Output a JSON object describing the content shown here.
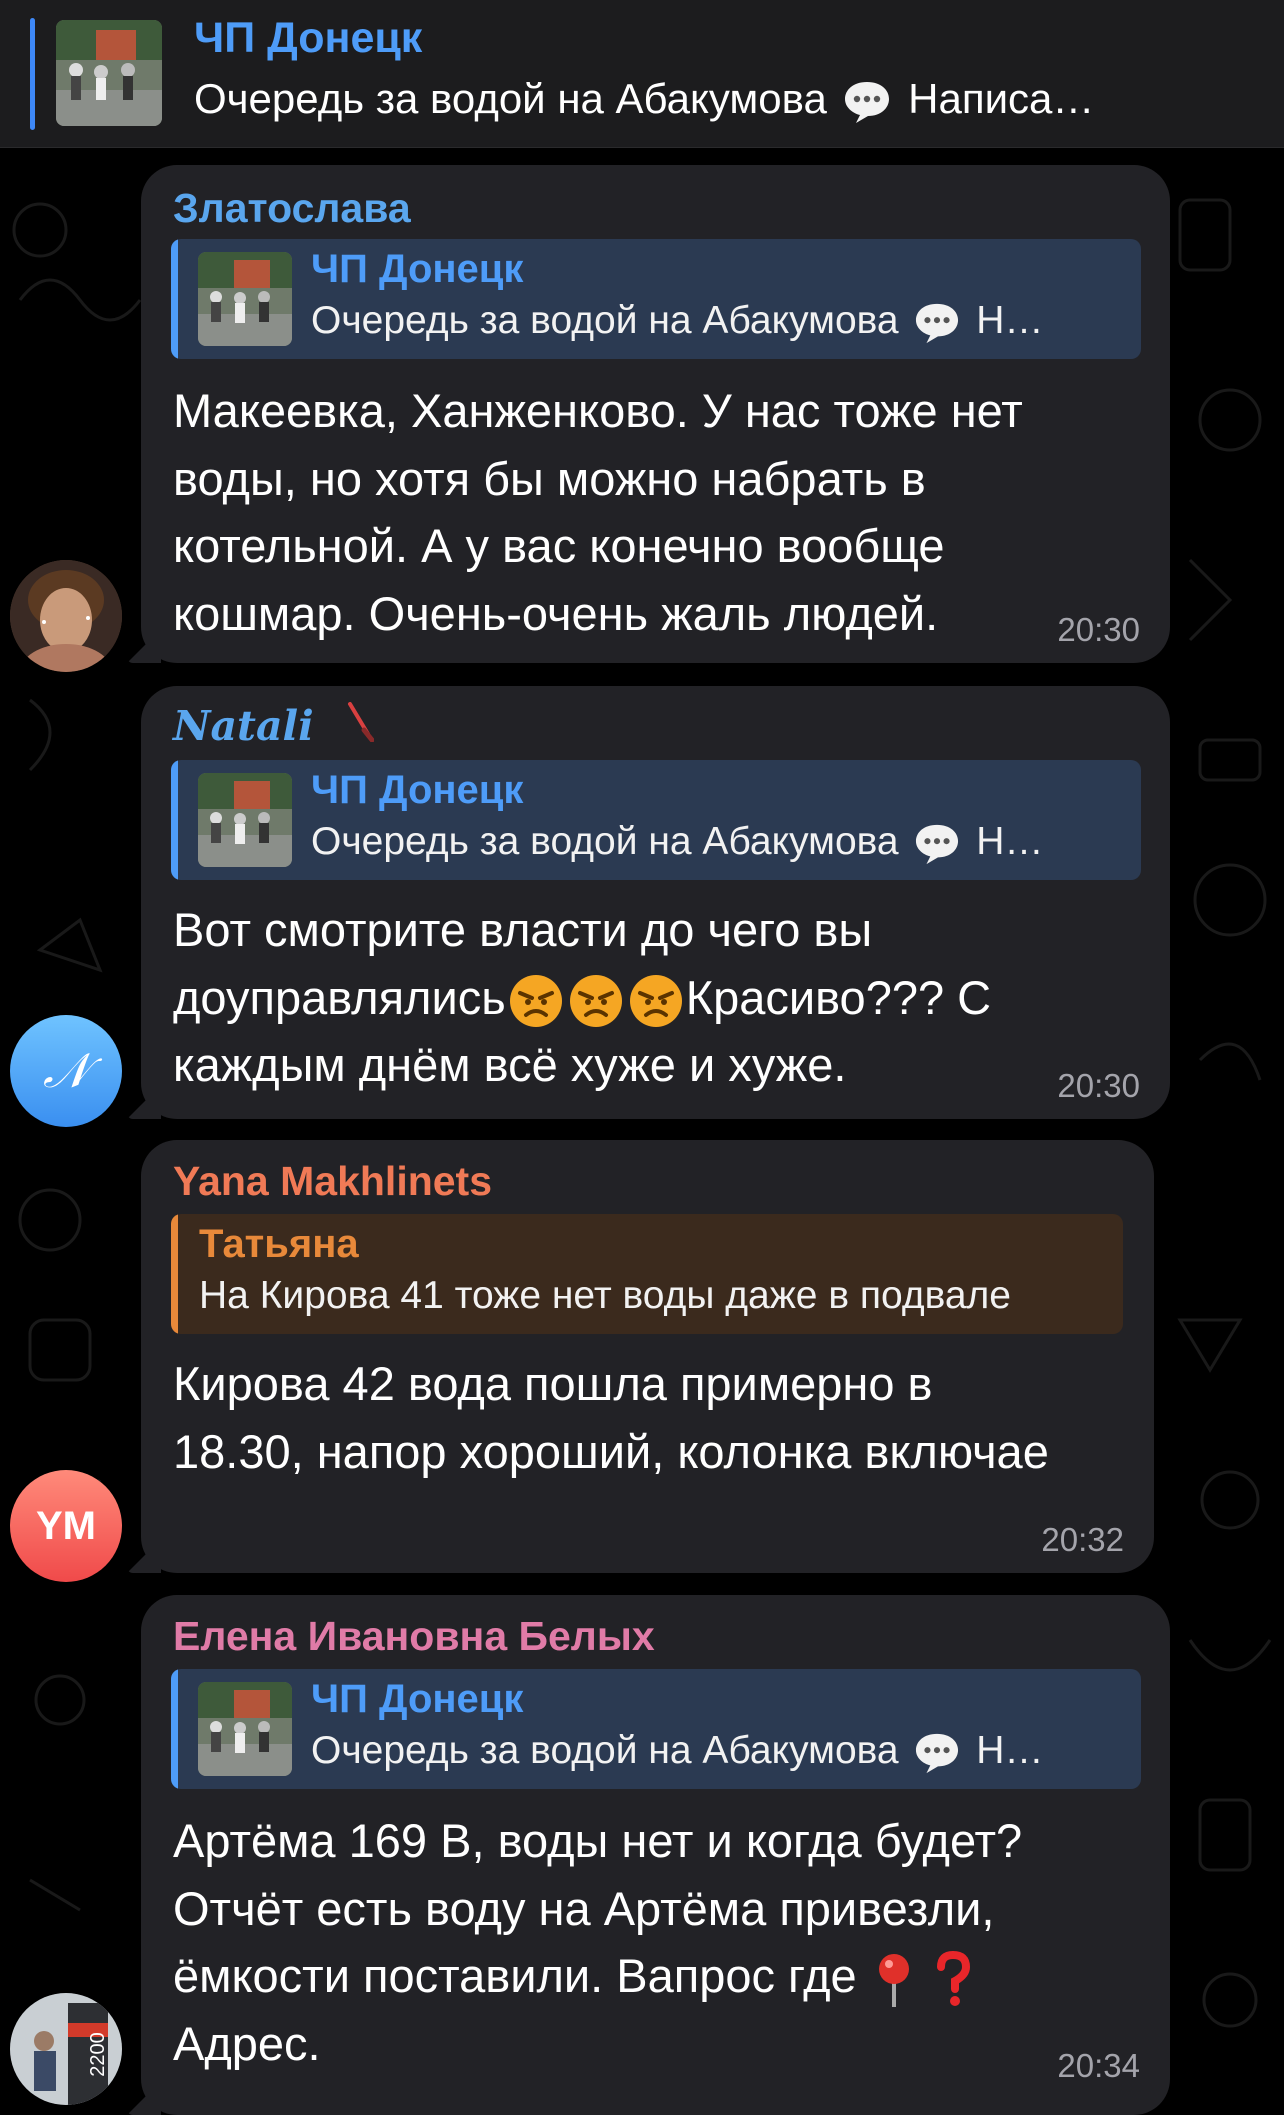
{
  "pinned": {
    "title": "ЧП Донецк",
    "text_before": "Очередь за водой на Абакумова",
    "text_after": "Написа…"
  },
  "messages": [
    {
      "sender": "Златослава",
      "sender_color": "#5aa6ee",
      "reply": {
        "title": "ЧП Донецк",
        "text_before": "Очередь за водой на Абакумова",
        "text_after": "Н…"
      },
      "text": "Макеевка, Ханженково. У нас тоже нет воды, но хотя бы можно набрать в котельной. А у вас конечно вообще кошмар. Очень-очень жаль людей.",
      "time": "20:30"
    },
    {
      "sender": "Natali",
      "sender_color": "#5aa6ee",
      "reply": {
        "title": "ЧП Донецк",
        "text_before": "Очередь за водой на Абакумова",
        "text_after": "Н…"
      },
      "text_part1": "Вот смотрите власти до чего вы доуправлялись",
      "emojis": "angry-face-emoji ×3",
      "text_part2": "Красиво??? С каждым днём всё хуже и хуже.",
      "time": "20:30"
    },
    {
      "sender": "Yana Makhlinets",
      "sender_color": "#f07a56",
      "reply": {
        "title": "Татьяна",
        "text": "На Кирова 41 тоже нет воды даже в подвале"
      },
      "text": "Кирова 42 вода пошла примерно в 18.30, напор хороший, колонка включае",
      "time": "20:32",
      "avatar_initials": "YM"
    },
    {
      "sender": "Елена Ивановна Белых",
      "sender_color": "#e07ba7",
      "reply": {
        "title": "ЧП Донецк",
        "text_before": "Очередь за водой на Абакумова",
        "text_after": "Н…"
      },
      "text_part1": "Артёма 169 В, воды нет и когда будет? Отчёт есть воду на Артёма привезли, ёмкости поставили. Вапрос где",
      "text_part2": "Адрес.",
      "time": "20:34"
    }
  ],
  "avatar_natali_letter": "𝒩",
  "avatar_elena_text": "2200",
  "colors": {
    "link_blue": "#4e9cf8",
    "bubble": "#222226",
    "reply_blue": "#2b3a52",
    "reply_orange": "#3b2a1d",
    "orange": "#e8893a"
  }
}
